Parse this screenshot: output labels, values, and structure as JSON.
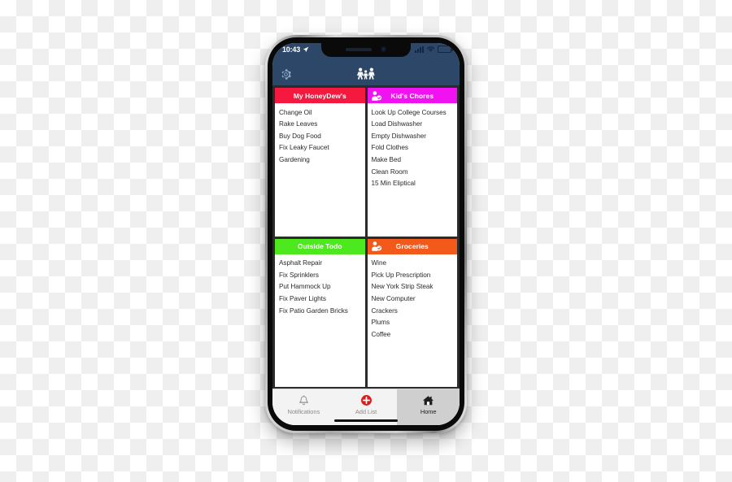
{
  "app": {
    "accent_header_bg": "#2c4767",
    "logo_icon": "family-people-icon",
    "settings_icon": "gear-icon"
  },
  "status_bar": {
    "time": "10:43",
    "location_icon": "location-arrow-icon",
    "signal_icon": "cellular-signal-icon",
    "wifi_icon": "wifi-icon",
    "battery_icon": "battery-icon"
  },
  "lists": [
    {
      "title": "My HoneyDew's",
      "color": "#f5183f",
      "icon": null,
      "items": [
        "Change Oil",
        "Rake Leaves",
        "Buy Dog Food",
        "Fix Leaky Faucet",
        "Gardening"
      ]
    },
    {
      "title": "Kid's Chores",
      "color": "#f012f0",
      "icon": "person-check-icon",
      "items": [
        "Look Up College Courses",
        "Load Dishwasher",
        "Empty Dishwasher",
        "Fold Clothes",
        "Make Bed",
        "Clean Room",
        "15 Min Eliptical"
      ]
    },
    {
      "title": "Outside Todo",
      "color": "#4ee81e",
      "icon": null,
      "items": [
        "Asphalt Repair",
        "Fix Sprinklers",
        "Put Hammock Up",
        "Fix Paver Lights",
        "Fix Patio Garden Bricks"
      ]
    },
    {
      "title": "Groceries",
      "color": "#f4591c",
      "icon": "person-check-icon",
      "items": [
        "Wine",
        "Pick Up Prescription",
        "New York Strip Steak",
        "New Computer",
        "Crackers",
        "Plums",
        "Coffee"
      ]
    }
  ],
  "tab_bar": {
    "tabs": [
      {
        "label": "Notifications",
        "icon": "bell-icon",
        "active": false
      },
      {
        "label": "Add List",
        "icon": "plus-circle-icon",
        "active": false
      },
      {
        "label": "Home",
        "icon": "home-icon",
        "active": true
      }
    ],
    "add_button_color": "#e01b1b"
  }
}
